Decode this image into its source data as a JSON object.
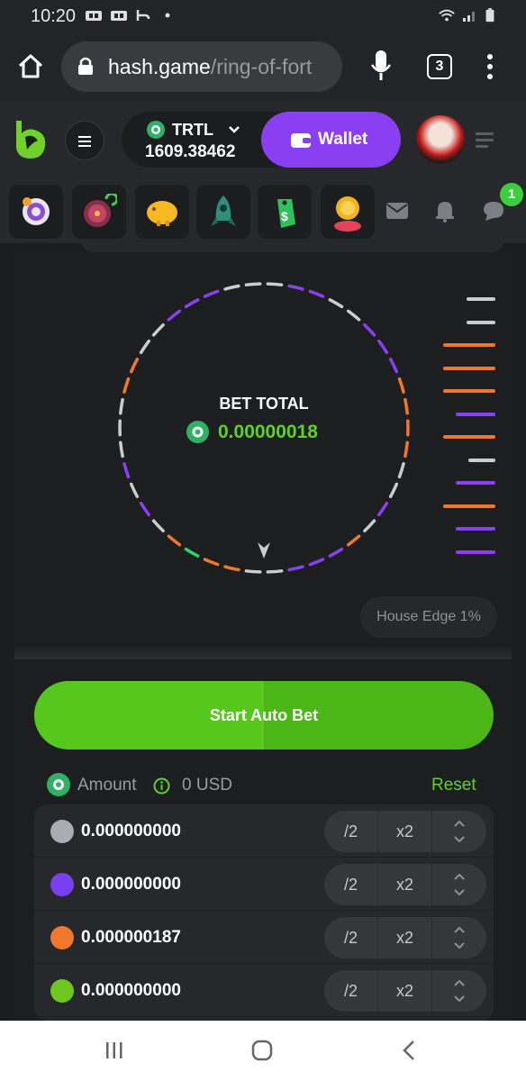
{
  "status_bar": {
    "time": "10:20"
  },
  "browser": {
    "domain": "hash.game",
    "path": "/ring-of-fort",
    "tab_count": "3"
  },
  "header": {
    "currency_code": "TRTL",
    "balance": "1609.38462",
    "wallet_label": "Wallet"
  },
  "quick_icons": [
    "target-icon",
    "wheel-icon",
    "piggy-bank-icon",
    "rocket-icon",
    "price-tag-icon",
    "coin-trophy-icon",
    "mail-icon",
    "bell-icon",
    "chat-icon"
  ],
  "chat_badge": "1",
  "game": {
    "bet_total_label": "BET TOTAL",
    "bet_total_value": "0.00000018",
    "house_edge": "House Edge 1%"
  },
  "controls": {
    "start_button": "Start Auto Bet",
    "amount_label": "Amount",
    "amount_usd": "0 USD",
    "reset_label": "Reset",
    "rows": [
      {
        "color": "#a9acb2",
        "value": "0.000000000",
        "half": "/2",
        "double": "x2"
      },
      {
        "color": "#7b3ff2",
        "value": "0.000000000",
        "half": "/2",
        "double": "x2"
      },
      {
        "color": "#f0772b",
        "value": "0.000000187",
        "half": "/2",
        "double": "x2"
      },
      {
        "color": "#6dc71f",
        "value": "0.000000000",
        "half": "/2",
        "double": "x2"
      }
    ]
  },
  "colors": {
    "accent_green": "#5fd12a",
    "purple": "#8a3ff2",
    "orange": "#f0772b",
    "grey": "#c9ccd1",
    "green": "#2fd16a"
  }
}
